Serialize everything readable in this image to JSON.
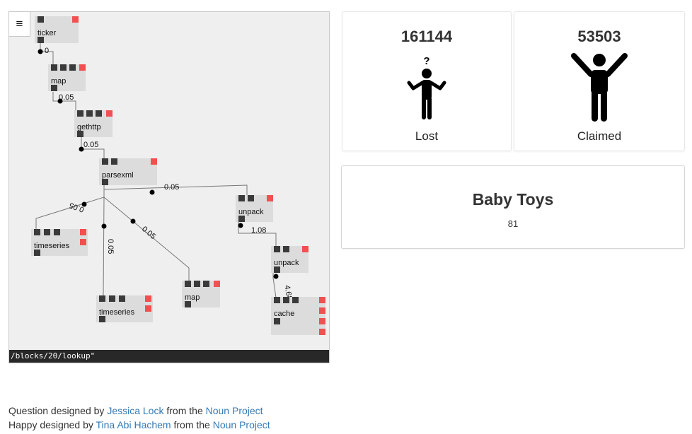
{
  "editor": {
    "menu_icon": "hamburger-icon",
    "command_line": "/blocks/20/lookup\"",
    "blocks": [
      {
        "id": "ticker",
        "label": "ticker"
      },
      {
        "id": "map1",
        "label": "map"
      },
      {
        "id": "gethttp",
        "label": "gethttp"
      },
      {
        "id": "parsexml",
        "label": "parsexml"
      },
      {
        "id": "unpack1",
        "label": "unpack"
      },
      {
        "id": "timeseries1",
        "label": "timeseries"
      },
      {
        "id": "timeseries2",
        "label": "timeseries"
      },
      {
        "id": "map2",
        "label": "map"
      },
      {
        "id": "unpack2",
        "label": "unpack"
      },
      {
        "id": "cache",
        "label": "cache"
      }
    ],
    "wire_labels": {
      "ticker_map": "0",
      "map_gethttp": "0.05",
      "gethttp_parsexml": "0.05",
      "parsexml_unpack": "0.05",
      "parsexml_timeseries1": "0.05",
      "parsexml_timeseries2": "0.05",
      "parsexml_map": "0.05",
      "unpack_unpack": "1.08",
      "unpack_cache": "4.68"
    }
  },
  "stats": {
    "lost": {
      "count": "161144",
      "label": "Lost",
      "icon": "question-person-icon"
    },
    "claimed": {
      "count": "53503",
      "label": "Claimed",
      "icon": "happy-person-icon"
    }
  },
  "category": {
    "title": "Baby Toys",
    "count": "81"
  },
  "credits": {
    "line1": {
      "prefix": "Question designed by ",
      "author": "Jessica Lock",
      "middle": " from the ",
      "source": "Noun Project"
    },
    "line2": {
      "prefix": "Happy designed by ",
      "author": "Tina Abi Hachem",
      "middle": " from the ",
      "source": "Noun Project"
    }
  },
  "colors": {
    "route_port": "#f05050",
    "port": "#3a3a3a",
    "block_bg": "#dcdcdc",
    "link": "#337ab7"
  }
}
